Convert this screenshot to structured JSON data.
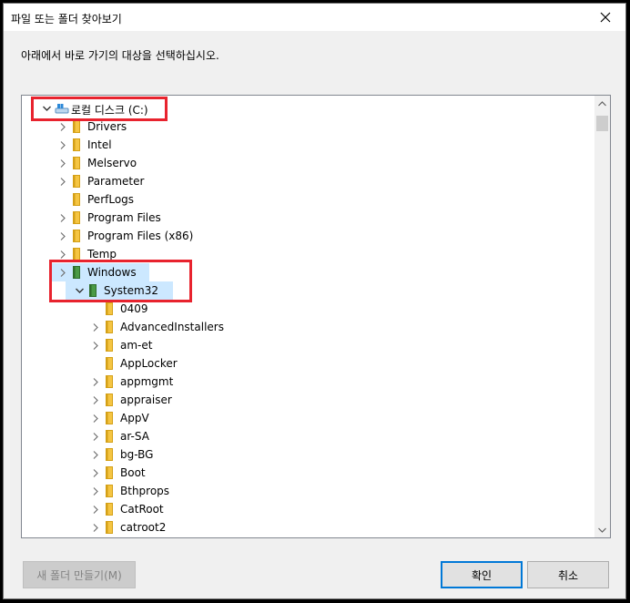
{
  "window": {
    "title": "파일 또는 폴더 찾아보기",
    "close_icon": "close-icon"
  },
  "instruction": "아래에서 바로 가기의 대상을 선택하십시오.",
  "tree": {
    "root": {
      "label": "로컬 디스크 (C:)",
      "icon": "drive-icon"
    },
    "items": [
      {
        "label": "Drivers",
        "expandable": true
      },
      {
        "label": "Intel",
        "expandable": true
      },
      {
        "label": "Melservo",
        "expandable": true
      },
      {
        "label": "Parameter",
        "expandable": true
      },
      {
        "label": "PerfLogs",
        "expandable": false
      },
      {
        "label": "Program Files",
        "expandable": true
      },
      {
        "label": "Program Files (x86)",
        "expandable": true
      },
      {
        "label": "Temp",
        "expandable": true
      },
      {
        "label": "Windows",
        "expandable": true,
        "selected": true
      }
    ],
    "system32": {
      "label": "System32",
      "selected": true
    },
    "children": [
      {
        "label": "0409",
        "expandable": false
      },
      {
        "label": "AdvancedInstallers",
        "expandable": true
      },
      {
        "label": "am-et",
        "expandable": true
      },
      {
        "label": "AppLocker",
        "expandable": false
      },
      {
        "label": "appmgmt",
        "expandable": true
      },
      {
        "label": "appraiser",
        "expandable": true
      },
      {
        "label": "AppV",
        "expandable": true
      },
      {
        "label": "ar-SA",
        "expandable": true
      },
      {
        "label": "bg-BG",
        "expandable": true
      },
      {
        "label": "Boot",
        "expandable": true
      },
      {
        "label": "Bthprops",
        "expandable": true
      },
      {
        "label": "CatRoot",
        "expandable": true
      },
      {
        "label": "catroot2",
        "expandable": true
      }
    ]
  },
  "buttons": {
    "new_folder": "새 폴더 만들기(M)",
    "ok": "확인",
    "cancel": "취소"
  },
  "colors": {
    "selection": "#cce8ff",
    "highlight_box": "#e8232e",
    "folder": "#f5c542",
    "accent": "#0078d7"
  }
}
